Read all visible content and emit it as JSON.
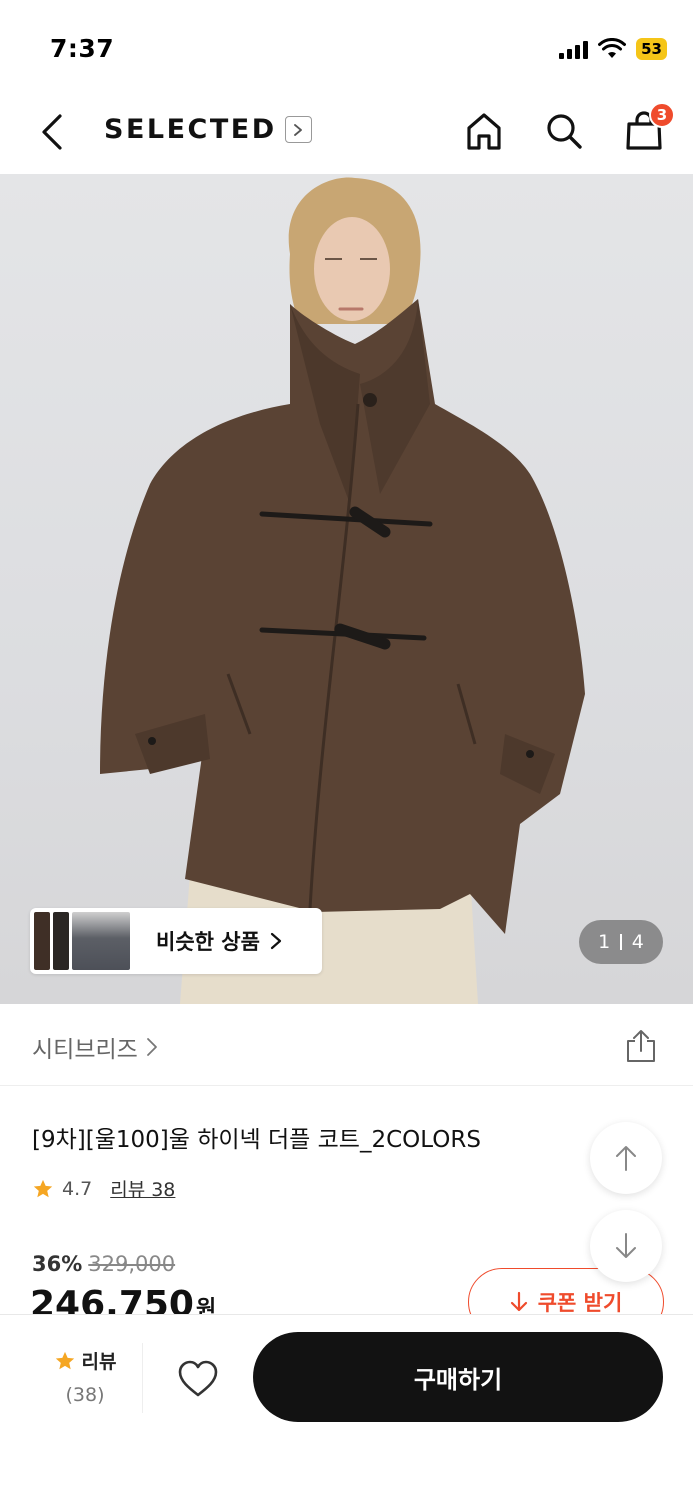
{
  "status_bar": {
    "time": "7:37",
    "battery": "53"
  },
  "header": {
    "brand": "SELECTED",
    "cart_count": "3"
  },
  "hero": {
    "similar_label": "비슷한 상품",
    "pager": {
      "current": "1",
      "total": "4"
    }
  },
  "store": {
    "name": "시티브리즈"
  },
  "product": {
    "title": "[9차][울100]울 하이넥 더플 코트_2COLORS",
    "rating": "4.7",
    "review_link": "리뷰 38",
    "discount": "36%",
    "original_price": "329,000",
    "final_price": "246,750",
    "currency": "원"
  },
  "coupon": {
    "label": "쿠폰 받기"
  },
  "bottom": {
    "review_label": "리뷰",
    "review_count": "(38)",
    "buy_label": "구매하기"
  },
  "colors": {
    "accent": "#ef4b2c",
    "star": "#f5a623",
    "buy_button": "#121212",
    "coat": "#5a4334"
  }
}
